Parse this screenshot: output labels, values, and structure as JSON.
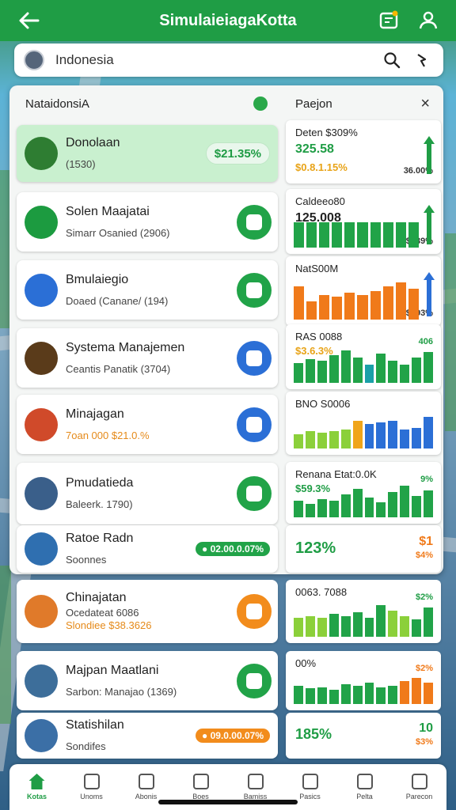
{
  "app": {
    "title": "SimulaieiagaKotta",
    "accent": "#1f9d45"
  },
  "search": {
    "value": "Indonesia"
  },
  "left_panel": {
    "title": "NataidonsiA"
  },
  "right_panel": {
    "title": "Paejon",
    "close": "×"
  },
  "list": [
    {
      "name": "Donolaan",
      "sub": "(1530)",
      "badge": "$21.35%",
      "badge_type": "chip",
      "color": "#2e7d32"
    },
    {
      "name": "Solen Maajatai",
      "sub": "Simarr Osanied (2906)",
      "action_color": "#21a348",
      "color": "#1c9b40"
    },
    {
      "name": "Bmulaiegio",
      "sub": "Doaed (Canane/ (194)",
      "action_color": "#21a348",
      "color": "#2b6fd6"
    },
    {
      "name": "Systema Manajemen",
      "sub": "Ceantis Panatik (3704)",
      "action_color": "#2b6fd6",
      "color": "#5a3b1a"
    },
    {
      "name": "Minajagan",
      "sub": "7oan 000 $21.0.%",
      "sub_accent": true,
      "action_color": "#2b6fd6",
      "color": "#d04a2a"
    },
    {
      "name": "Pmudatieda",
      "sub": "Baleerk. 1790)",
      "action_color": "#21a348",
      "color": "#3a5f8a"
    },
    {
      "name": "Ratoe Radn",
      "sub": "Soonnes",
      "badge": "● 02.00.0.07%",
      "badge_type": "pill",
      "pill_color": "#21a348",
      "color": "#2f6fb0"
    },
    {
      "name": "Chinajatan",
      "sub": "Ocedateat 6086",
      "sub2": "Slondiee $38.3626",
      "action_color": "#f28c1c",
      "color": "#e07a2a"
    },
    {
      "name": "Majpan Maatlani",
      "sub": "Sarbon: Manajao (1369)",
      "action_color": "#21a348",
      "color": "#3d6e9a"
    },
    {
      "name": "Statishilan",
      "sub": "Sondifes",
      "badge": "● 09.0.00.07%",
      "badge_type": "pill",
      "pill_color": "#f28c1c",
      "color": "#3b6fa6"
    }
  ],
  "stats": [
    {
      "label": "Deten $309%",
      "value": "325.58",
      "value_color": "#1f9d45",
      "sub": "$0.8.1.15%",
      "sub_color": "#e8a317",
      "right": "36.00%",
      "trend": "up",
      "trend_color": "#1f9d45",
      "bars": []
    },
    {
      "label": "Caldeeo80",
      "value": "125.008",
      "right": "$039%",
      "trend": "up",
      "trend_color": "#1f9d45",
      "bars": [
        0.7,
        0.7,
        0.7,
        0.7,
        0.7,
        0.7,
        0.7,
        0.7,
        0.7,
        0.7
      ],
      "bar_colors": [
        "#21a348"
      ]
    },
    {
      "label": "NatS00M",
      "right": "$793%",
      "trend": "up",
      "trend_color": "#2b6fd6",
      "bars": [
        0.8,
        0.45,
        0.6,
        0.55,
        0.65,
        0.6,
        0.7,
        0.8,
        0.9,
        0.75
      ],
      "bar_colors": [
        "#f07a1a"
      ]
    },
    {
      "label": "RAS 0088",
      "sub": "$3.6.3%",
      "sub_color": "#e8a317",
      "right": "406",
      "right_color": "#1f9d45",
      "bars": [
        0.55,
        0.65,
        0.6,
        0.75,
        0.9,
        0.7,
        0.5,
        0.8,
        0.6,
        0.5,
        0.7,
        0.85
      ],
      "bar_colors": [
        "#21a348",
        "#21a348",
        "#21a348",
        "#21a348",
        "#21a348",
        "#21a348",
        "#1aa0a8",
        "#21a348",
        "#21a348",
        "#21a348",
        "#21a348",
        "#21a348"
      ]
    },
    {
      "label": "BNO S0006",
      "bars": [
        0.4,
        0.5,
        0.45,
        0.5,
        0.55,
        0.8,
        0.7,
        0.75,
        0.8,
        0.55,
        0.6,
        0.9
      ],
      "bar_colors": [
        "#8bd03a",
        "#8bd03a",
        "#8bd03a",
        "#8bd03a",
        "#8bd03a",
        "#f0a51a",
        "#2b6fd6",
        "#2b6fd6",
        "#2b6fd6",
        "#2b6fd6",
        "#2b6fd6",
        "#2b6fd6"
      ]
    },
    {
      "label": "Renana Etat:0.0K",
      "sub": "$59.3%",
      "sub_color": "#1f9d45",
      "right": "9%",
      "right_color": "#1f9d45",
      "bars": [
        0.5,
        0.4,
        0.55,
        0.5,
        0.7,
        0.85,
        0.6,
        0.45,
        0.75,
        0.95,
        0.65,
        0.8
      ],
      "bar_colors": [
        "#21a348"
      ]
    },
    {
      "label": "",
      "value": "123%",
      "value_color": "#1f9d45",
      "value_size": 20,
      "right": "$1",
      "right_color": "#f07a1a",
      "right2": "$4%",
      "bars": []
    },
    {
      "label": "0063. 7088",
      "right": "$2%",
      "right_color": "#1f9d45",
      "bars": [
        0.55,
        0.6,
        0.55,
        0.65,
        0.6,
        0.7,
        0.55,
        0.9,
        0.75,
        0.6,
        0.5,
        0.85
      ],
      "bar_colors": [
        "#8bd03a",
        "#8bd03a",
        "#8bd03a",
        "#21a348",
        "#21a348",
        "#21a348",
        "#21a348",
        "#21a348",
        "#8bd03a",
        "#8bd03a",
        "#21a348",
        "#21a348"
      ]
    },
    {
      "label": "00%",
      "right": "$2%",
      "right_color": "#f07a1a",
      "bars": [
        0.6,
        0.5,
        0.55,
        0.45,
        0.65,
        0.6,
        0.7,
        0.55,
        0.6,
        0.75,
        0.85,
        0.7
      ],
      "bar_colors": [
        "#21a348",
        "#21a348",
        "#21a348",
        "#21a348",
        "#21a348",
        "#21a348",
        "#21a348",
        "#21a348",
        "#21a348",
        "#f07a1a",
        "#f07a1a",
        "#f07a1a"
      ]
    },
    {
      "label": "",
      "value": "185%",
      "value_color": "#1f9d45",
      "value_size": 18,
      "right": "10",
      "right_color": "#1f9d45",
      "right2": "$3%",
      "bars": []
    }
  ],
  "nav": [
    {
      "label": "Kotas",
      "active": true
    },
    {
      "label": "Unoms"
    },
    {
      "label": "Abonis"
    },
    {
      "label": "Boes"
    },
    {
      "label": "Bamiss"
    },
    {
      "label": "Pasics"
    },
    {
      "label": "Pelta"
    },
    {
      "label": "Parecon"
    }
  ]
}
